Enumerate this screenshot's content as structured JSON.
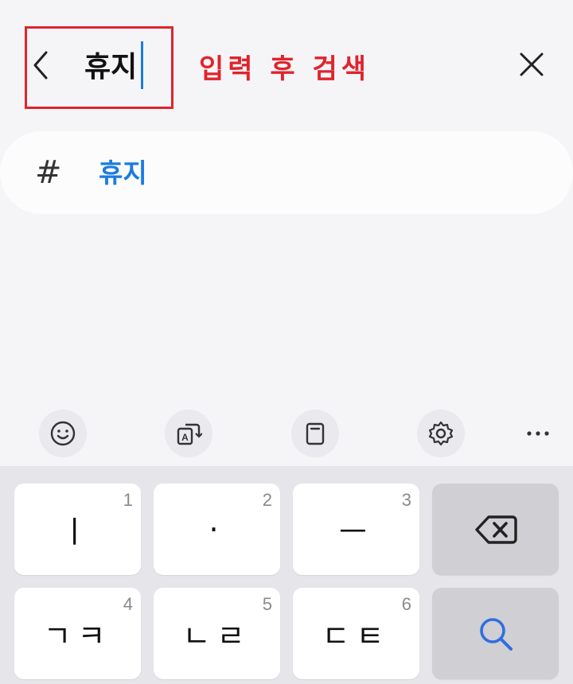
{
  "header": {
    "search_value": "휴지",
    "annotation": "입력 후 검색",
    "back_icon": "chevron-left-icon",
    "close_icon": "close-icon",
    "highlight_color": "#e0242c",
    "caret_color": "#1a7ce0"
  },
  "suggestions": [
    {
      "icon": "hash-icon",
      "symbol": "#",
      "text": "휴지"
    }
  ],
  "toolbar": {
    "items": [
      {
        "icon": "emoji-icon"
      },
      {
        "icon": "translate-icon"
      },
      {
        "icon": "clipboard-icon"
      },
      {
        "icon": "settings-icon"
      },
      {
        "icon": "more-icon"
      }
    ]
  },
  "keyboard": {
    "keys": [
      {
        "num": "1",
        "glyph": "ㅣ"
      },
      {
        "num": "2",
        "glyph": "·"
      },
      {
        "num": "3",
        "glyph": "ㅡ"
      },
      {
        "num": "",
        "glyph": "",
        "icon": "backspace-icon"
      },
      {
        "num": "4",
        "glyph": "ㄱㅋ"
      },
      {
        "num": "5",
        "glyph": "ㄴㄹ"
      },
      {
        "num": "6",
        "glyph": "ㄷㅌ"
      },
      {
        "num": "",
        "glyph": "",
        "icon": "search-icon"
      }
    ]
  }
}
